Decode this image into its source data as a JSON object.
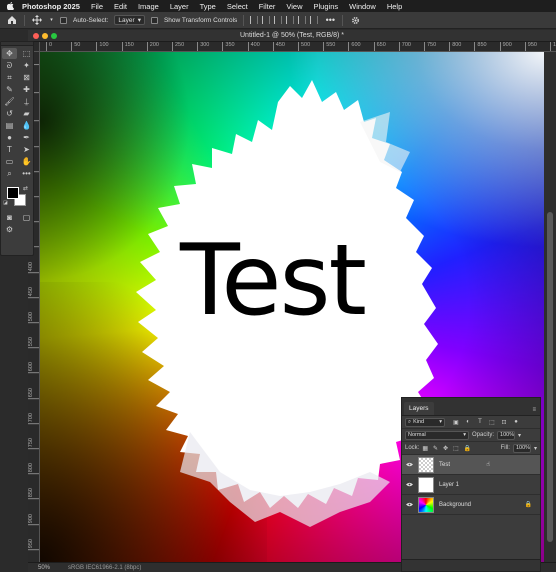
{
  "menubar": {
    "app": "Photoshop 2025",
    "items": [
      "File",
      "Edit",
      "Image",
      "Layer",
      "Type",
      "Select",
      "Filter",
      "View",
      "Plugins",
      "Window",
      "Help"
    ]
  },
  "options": {
    "auto_select_label": "Auto-Select:",
    "auto_select_target": "Layer",
    "transform_controls_label": "Show Transform Controls"
  },
  "document": {
    "title": "Untitled-1 @ 50% (Test, RGB/8) *",
    "zoom": "50%",
    "profile": "sRGB IEC61966-2.1 (8bpc)",
    "canvas_text": "Test",
    "ruler_top": [
      "0",
      "50",
      "100",
      "150",
      "200",
      "250",
      "300",
      "350",
      "400",
      "450",
      "500",
      "550",
      "600",
      "650",
      "700",
      "750",
      "800",
      "850",
      "900",
      "950",
      "1000"
    ],
    "ruler_left": [
      "0",
      "50",
      "100",
      "150",
      "200",
      "250",
      "300",
      "350",
      "400",
      "450",
      "500",
      "550",
      "600",
      "650",
      "700",
      "750",
      "800",
      "850",
      "900",
      "950",
      "1000"
    ]
  },
  "layers_panel": {
    "tab": "Layers",
    "filter_kind": "Kind",
    "blend_mode": "Normal",
    "opacity_label": "Opacity:",
    "opacity_value": "100%",
    "lock_label": "Lock:",
    "fill_label": "Fill:",
    "fill_value": "100%",
    "layers": [
      {
        "name": "Test",
        "selected": true,
        "thumb": "checker"
      },
      {
        "name": "Layer 1",
        "selected": false,
        "thumb": "white"
      },
      {
        "name": "Background",
        "selected": false,
        "thumb": "rainbow",
        "locked": true
      }
    ]
  },
  "colors": {
    "foreground": "#000000",
    "background": "#ffffff",
    "accent": "#e88b2e"
  }
}
